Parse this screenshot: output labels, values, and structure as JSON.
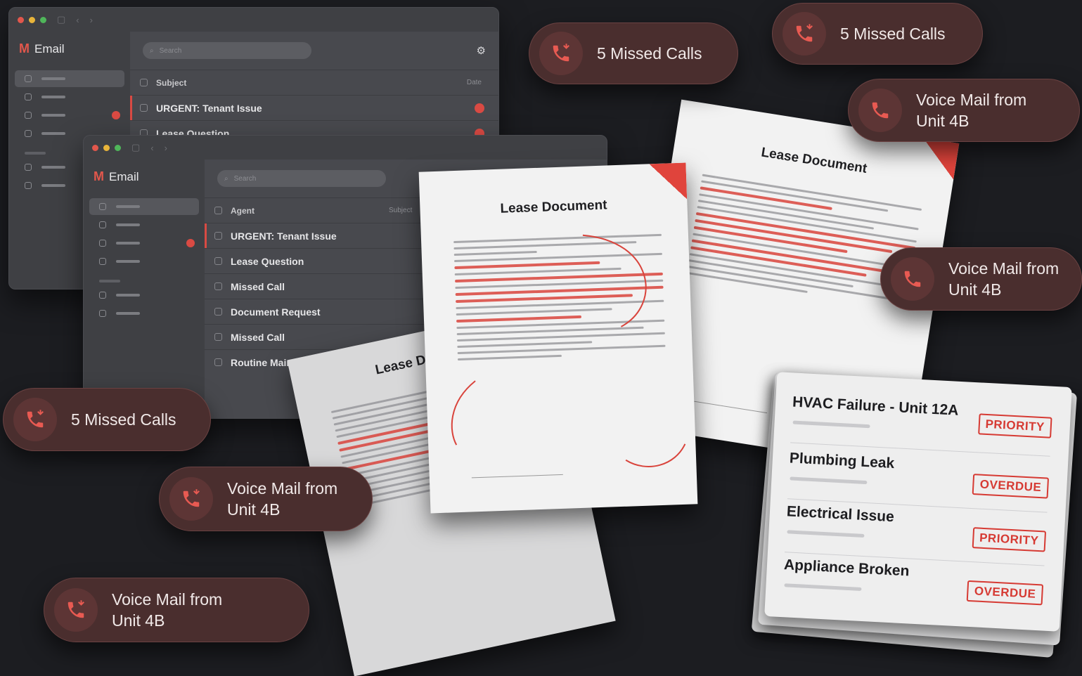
{
  "windows": [
    {
      "app_name": "Email",
      "search_placeholder": "Search",
      "rows": [
        {
          "label": "Subject",
          "meta": "Date"
        },
        {
          "label": "URGENT: Tenant Issue"
        },
        {
          "label": "Lease Question"
        }
      ]
    },
    {
      "app_name": "Email",
      "search_placeholder": "Search",
      "rows": [
        {
          "label": "Agent",
          "meta": "Subject"
        },
        {
          "label": "URGENT: Tenant Issue"
        },
        {
          "label": "Lease Question"
        },
        {
          "label": "Missed Call"
        },
        {
          "label": "Document Request"
        },
        {
          "label": "Missed Call"
        },
        {
          "label": "Routine Maintenance"
        }
      ]
    }
  ],
  "documents": [
    {
      "title": "Lease Document"
    },
    {
      "title": "Lease Document"
    },
    {
      "title": "Lease Document"
    }
  ],
  "call_pills": [
    {
      "text": "5 Missed Calls"
    },
    {
      "text": "5 Missed Calls"
    },
    {
      "text": "Voice Mail from Unit 4B"
    },
    {
      "text": "Voice Mail from Unit 4B"
    },
    {
      "text": "5 Missed Calls"
    },
    {
      "text": "Voice Mail from Unit 4B"
    },
    {
      "text": "Voice Mail from Unit 4B"
    }
  ],
  "tickets": [
    {
      "title": "HVAC Failure - Unit 12A",
      "status": "PRIORITY"
    },
    {
      "title": "Plumbing Leak",
      "status": "OVERDUE"
    },
    {
      "title": "Electrical Issue",
      "status": "PRIORITY"
    },
    {
      "title": "Appliance Broken",
      "status": "OVERDUE"
    }
  ],
  "colors": {
    "background": "#1c1d21",
    "accent_red": "#d94a43",
    "pill_bg": "#4a2e2e"
  },
  "icons": [
    "phone-missed-icon",
    "phone-icon",
    "mail-logo-icon",
    "search-icon",
    "gear-icon"
  ]
}
